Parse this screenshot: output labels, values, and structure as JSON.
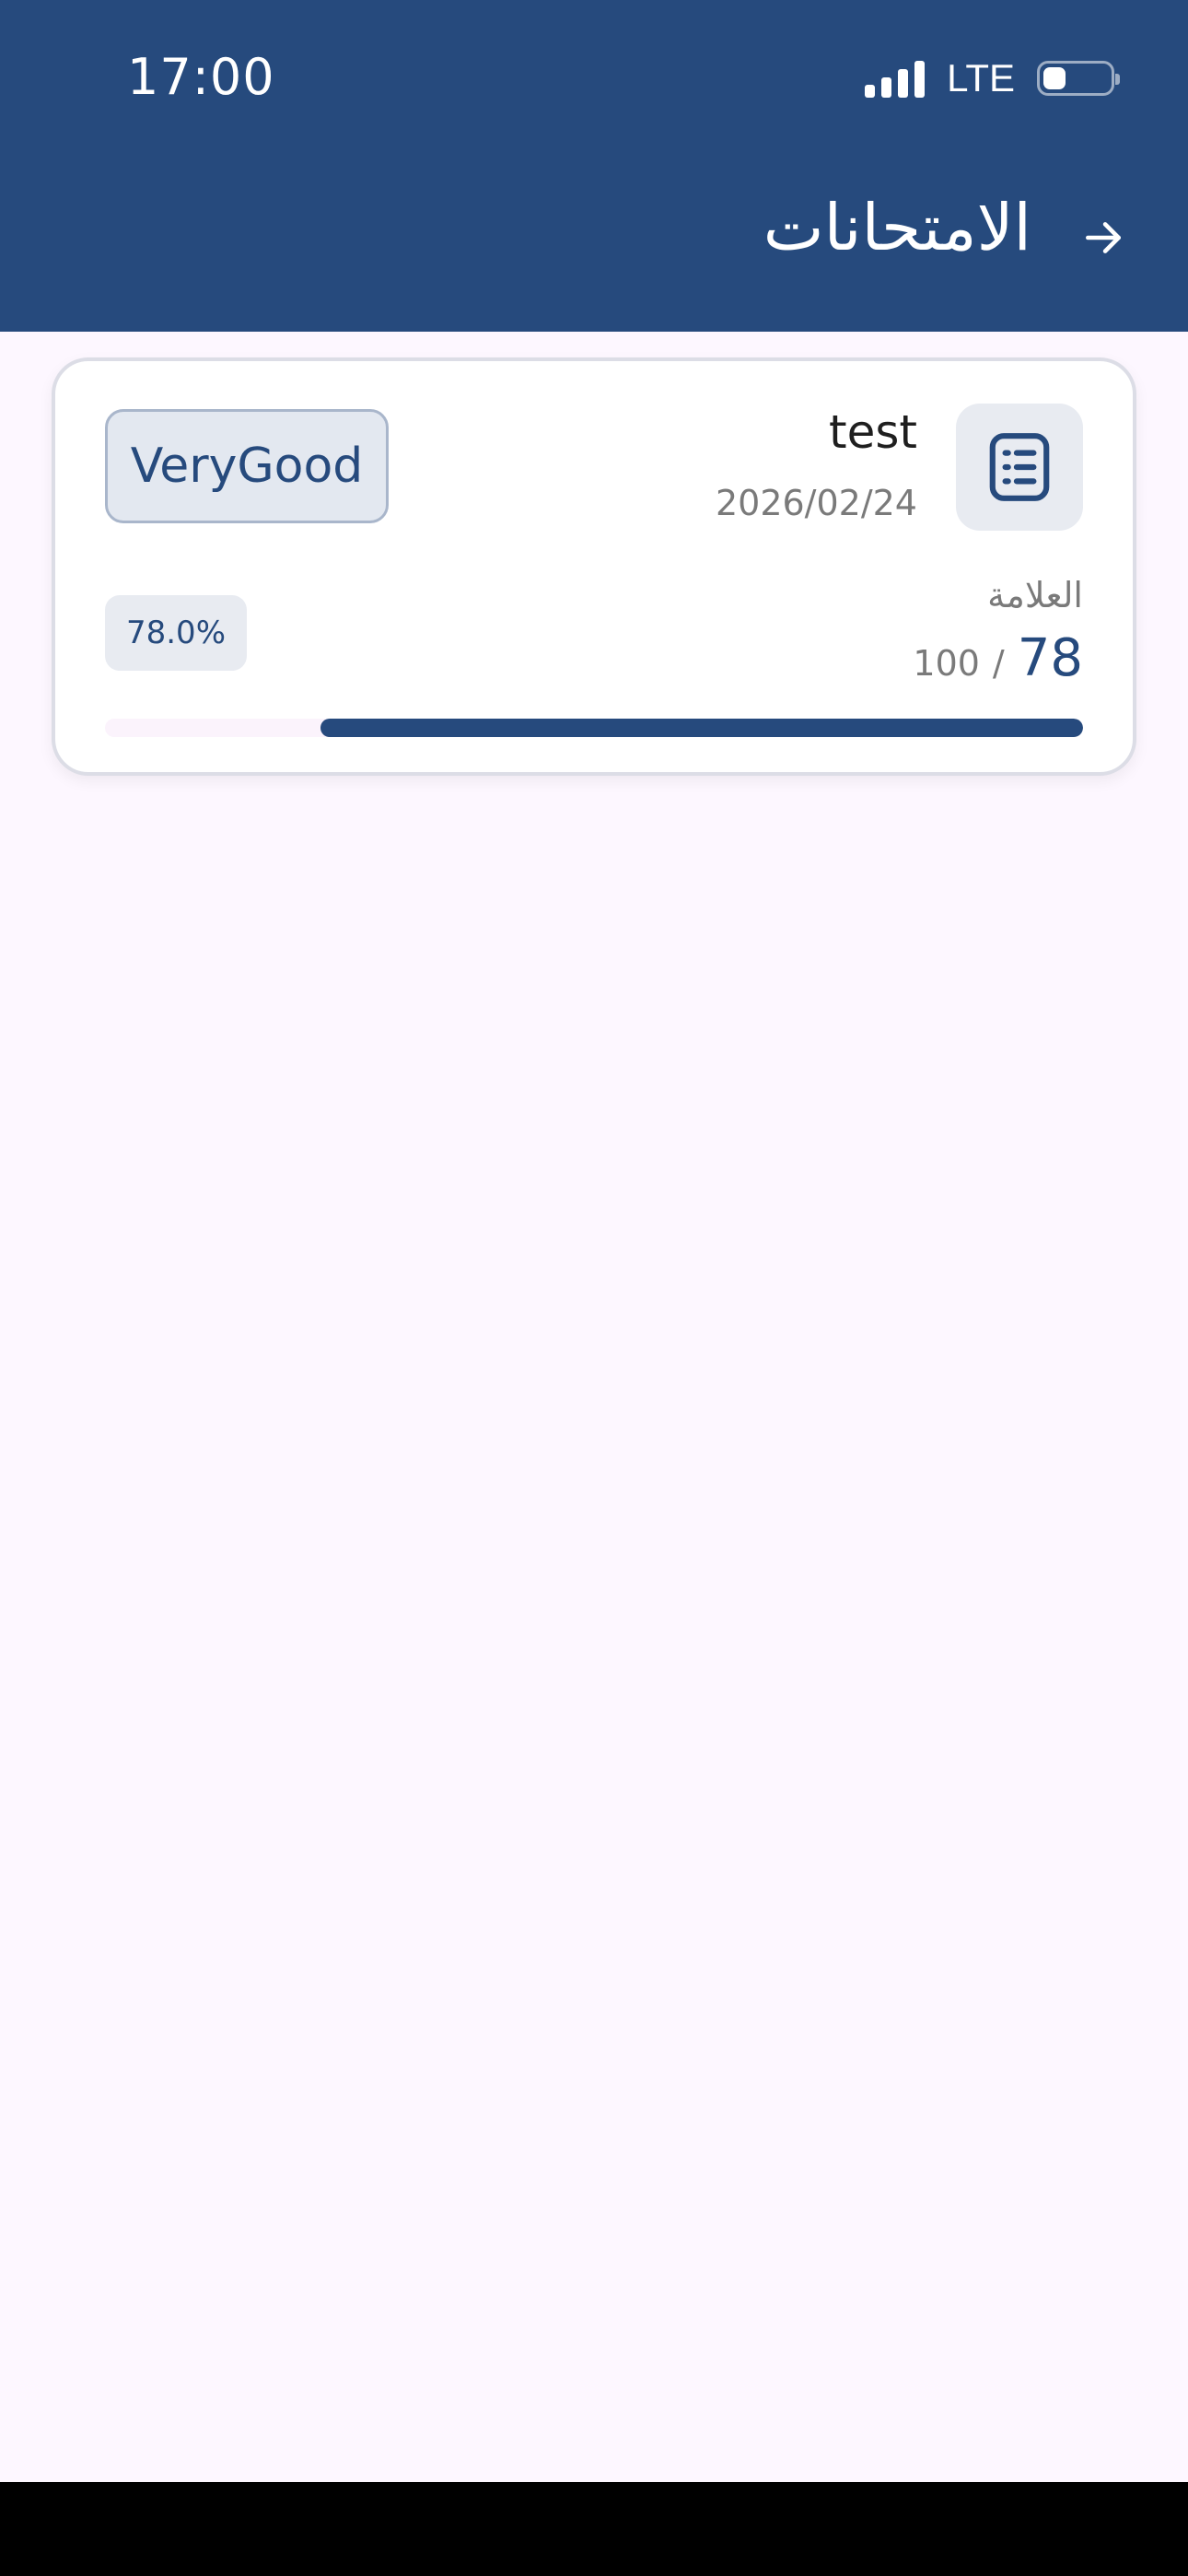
{
  "status_bar": {
    "time": "17:00",
    "network": "LTE",
    "battery_icon": "battery-icon",
    "signal_icon": "signal-icon"
  },
  "header": {
    "title": "الامتحانات",
    "back_icon": "arrow-right-icon",
    "background_color": "#264a7d"
  },
  "exams": [
    {
      "name": "test",
      "date": "2026/02/24",
      "grade": "VeryGood",
      "score_label": "العلامة",
      "score": "78",
      "separator": "/",
      "total": "100",
      "percent_text": "78.0%",
      "progress": 0.78,
      "icon": "list-document-icon"
    }
  ],
  "colors": {
    "primary": "#264a7d",
    "background": "#fdf7ff"
  }
}
